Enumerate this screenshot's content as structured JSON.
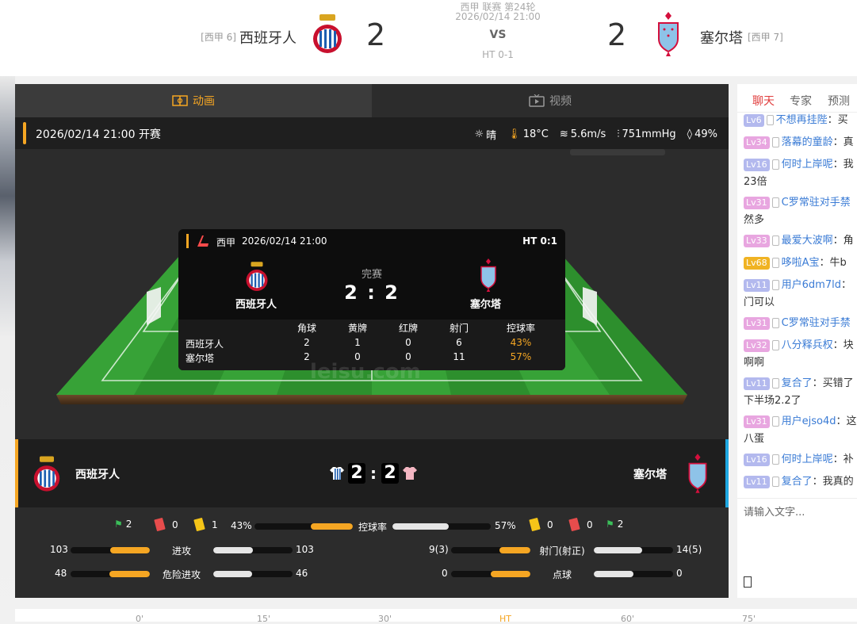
{
  "header": {
    "league_round": "西甲 联赛 第24轮",
    "kickoff": "2026/02/14 21:00",
    "vs": "VS",
    "halftime": "HT 0-1",
    "home": {
      "rank": "[西甲 6]",
      "name": "西班牙人",
      "score": "2"
    },
    "away": {
      "rank": "[西甲 7]",
      "name": "塞尔塔",
      "score": "2"
    }
  },
  "tabs": {
    "animation": "动画",
    "video": "视频"
  },
  "infobar": {
    "datetime": "2026/02/14 21:00 开赛",
    "weather": "晴",
    "temperature": "18°C",
    "wind": "5.6m/s",
    "pressure": "751mmHg",
    "humidity": "49%"
  },
  "overlay": {
    "league": "西甲",
    "datetime": "2026/02/14 21:00",
    "ht": "HT 0:1",
    "status": "完赛",
    "score": "2 : 2",
    "home_name": "西班牙人",
    "away_name": "塞尔塔",
    "columns": [
      "角球",
      "黄牌",
      "红牌",
      "射门",
      "控球率"
    ],
    "rows": [
      {
        "team": "西班牙人",
        "values": [
          "2",
          "1",
          "0",
          "6",
          "43%"
        ]
      },
      {
        "team": "塞尔塔",
        "values": [
          "2",
          "0",
          "0",
          "11",
          "57%"
        ]
      }
    ],
    "watermark": "leisu.com"
  },
  "teambar": {
    "home_name": "西班牙人",
    "away_name": "塞尔塔",
    "home_score": "2",
    "away_score": "2"
  },
  "stats": {
    "home_events": {
      "corners": "2",
      "red": "0",
      "yellow": "1"
    },
    "away_events": {
      "yellow": "0",
      "red": "0",
      "corners": "2"
    },
    "possession": {
      "label": "控球率",
      "home": "43%",
      "away": "57%",
      "home_frac": 0.43,
      "away_frac": 0.57
    },
    "attack": {
      "label": "进攻",
      "home": "103",
      "away": "103",
      "home_frac": 0.5,
      "away_frac": 0.5
    },
    "dangerous": {
      "label": "危险进攻",
      "home": "48",
      "away": "46",
      "home_frac": 0.51,
      "away_frac": 0.49
    },
    "shots": {
      "label": "射门(射正)",
      "home": "9(3)",
      "away": "14(5)",
      "home_frac": 0.39,
      "away_frac": 0.61
    },
    "penalty": {
      "label": "点球",
      "home": "0",
      "away": "0",
      "home_frac": 0.5,
      "away_frac": 0.5
    }
  },
  "chat": {
    "tabs": [
      "聊天",
      "专家",
      "预测"
    ],
    "messages": [
      {
        "lv": "Lv6",
        "user": "不想再挂陛",
        "text": "：买"
      },
      {
        "lv": "Lv34",
        "user": "落幕的童龄",
        "text": "：真"
      },
      {
        "lv": "Lv16",
        "user": "何时上岸呢",
        "text": "：我",
        "wrap": "23倍"
      },
      {
        "lv": "Lv31",
        "user": "C罗常驻对手禁",
        "text": "",
        "wrap": "然多"
      },
      {
        "lv": "Lv33",
        "user": "最爱大波啊",
        "text": "：角"
      },
      {
        "lv": "Lv68",
        "user": "哆啦A宝",
        "text": "：牛b"
      },
      {
        "lv": "Lv11",
        "user": "用户6dm7ld",
        "text": "：",
        "wrap": "门可以"
      },
      {
        "lv": "Lv31",
        "user": "C罗常驻对手禁",
        "text": ""
      },
      {
        "lv": "Lv32",
        "user": "八分释兵权",
        "text": "：块",
        "wrap": "啊啊"
      },
      {
        "lv": "Lv11",
        "user": "复合了",
        "text": "：买错了",
        "wrap": "下半场2.2了"
      },
      {
        "lv": "Lv31",
        "user": "用户ejso4d",
        "text": "：这",
        "wrap": "八蛋"
      },
      {
        "lv": "Lv16",
        "user": "何时上岸呢",
        "text": "：补"
      },
      {
        "lv": "Lv11",
        "user": "复合了",
        "text": "：我真的"
      }
    ],
    "input_placeholder": "请输入文字..."
  },
  "timeline": {
    "marks": [
      "0'",
      "15'",
      "30'",
      "HT",
      "60'",
      "75'"
    ]
  },
  "colors": {
    "accent": "#f5a623",
    "home_bar": "#1ea7e1",
    "pitch": "#2f9a2f",
    "chat_link": "#3a7bd5"
  }
}
